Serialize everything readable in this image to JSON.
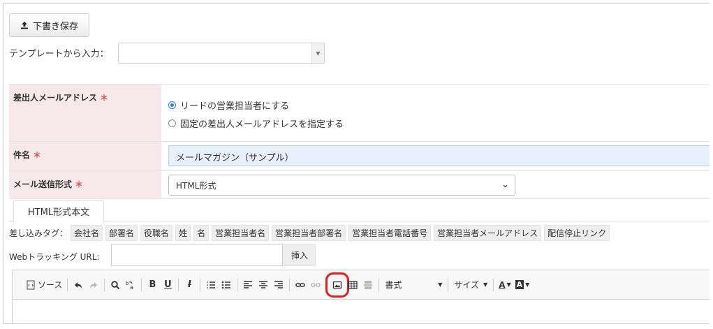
{
  "toolbar_top": {
    "draft_save_label": "下書き保存"
  },
  "template": {
    "label": "テンプレートから入力：",
    "value": ""
  },
  "form": {
    "sender": {
      "label": "差出人メールアドレス",
      "options": [
        "リードの営業担当者にする",
        "固定の差出人メールアドレスを指定する"
      ],
      "selected_index": 0
    },
    "subject": {
      "label": "件名",
      "value": "メールマガジン（サンプル）"
    },
    "format": {
      "label": "メール送信形式",
      "value": "HTML形式"
    },
    "required_mark": "＊"
  },
  "tabs": [
    {
      "label": "HTML形式本文"
    }
  ],
  "merge_tags": {
    "label": "差し込みタグ：",
    "items": [
      "会社名",
      "部署名",
      "役職名",
      "姓",
      "名",
      "営業担当者名",
      "営業担当者部署名",
      "営業担当者電話番号",
      "営業担当者メールアドレス",
      "配信停止リンク"
    ]
  },
  "tracking": {
    "label": "Webトラッキング URL:",
    "value": "",
    "insert_label": "挿入"
  },
  "editor_toolbar": {
    "source_label": "ソース",
    "format_label": "書式",
    "size_label": "サイズ",
    "highlighted": "image-icon"
  }
}
